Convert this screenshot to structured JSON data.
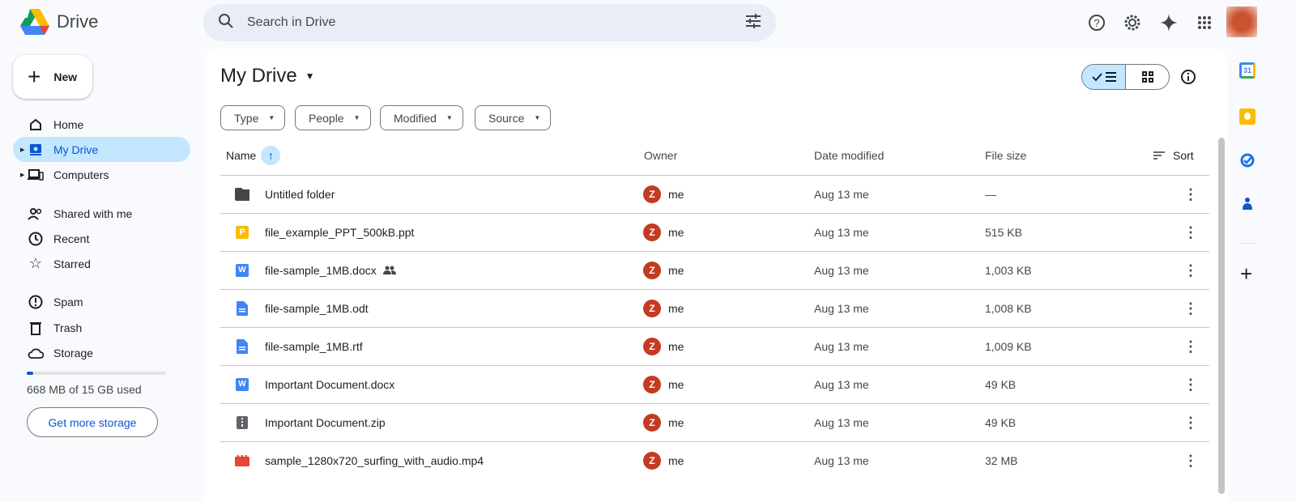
{
  "app": {
    "name": "Drive"
  },
  "search": {
    "placeholder": "Search in Drive"
  },
  "header_icons": [
    "help-icon",
    "settings-icon",
    "gemini-icon",
    "apps-icon"
  ],
  "sidebar": {
    "new_label": "New",
    "items": [
      {
        "label": "Home"
      },
      {
        "label": "My Drive"
      },
      {
        "label": "Computers"
      },
      {
        "label": "Shared with me"
      },
      {
        "label": "Recent"
      },
      {
        "label": "Starred"
      },
      {
        "label": "Spam"
      },
      {
        "label": "Trash"
      },
      {
        "label": "Storage"
      }
    ],
    "storage": {
      "text": "668 MB of 15 GB used",
      "used_fraction": 0.044,
      "button": "Get more storage"
    }
  },
  "main": {
    "title": "My Drive",
    "filters": [
      "Type",
      "People",
      "Modified",
      "Source"
    ],
    "columns": {
      "name": "Name",
      "owner": "Owner",
      "date": "Date modified",
      "size": "File size",
      "sort": "Sort"
    },
    "rows": [
      {
        "name": "Untitled folder",
        "type": "folder",
        "owner": "me",
        "owner_initial": "Z",
        "date": "Aug 13 me",
        "size": "—"
      },
      {
        "name": "file_example_PPT_500kB.ppt",
        "type": "ppt",
        "owner": "me",
        "owner_initial": "Z",
        "date": "Aug 13 me",
        "size": "515 KB"
      },
      {
        "name": "file-sample_1MB.docx",
        "type": "word",
        "shared": true,
        "owner": "me",
        "owner_initial": "Z",
        "date": "Aug 13 me",
        "size": "1,003 KB"
      },
      {
        "name": "file-sample_1MB.odt",
        "type": "doc",
        "owner": "me",
        "owner_initial": "Z",
        "date": "Aug 13 me",
        "size": "1,008 KB"
      },
      {
        "name": "file-sample_1MB.rtf",
        "type": "doc",
        "owner": "me",
        "owner_initial": "Z",
        "date": "Aug 13 me",
        "size": "1,009 KB"
      },
      {
        "name": "Important Document.docx",
        "type": "word",
        "owner": "me",
        "owner_initial": "Z",
        "date": "Aug 13 me",
        "size": "49 KB"
      },
      {
        "name": "Important Document.zip",
        "type": "zip",
        "owner": "me",
        "owner_initial": "Z",
        "date": "Aug 13 me",
        "size": "49 KB"
      },
      {
        "name": "sample_1280x720_surfing_with_audio.mp4",
        "type": "video",
        "owner": "me",
        "owner_initial": "Z",
        "date": "Aug 13 me",
        "size": "32 MB"
      }
    ]
  },
  "side_panel": {
    "calendar_day": "31"
  }
}
